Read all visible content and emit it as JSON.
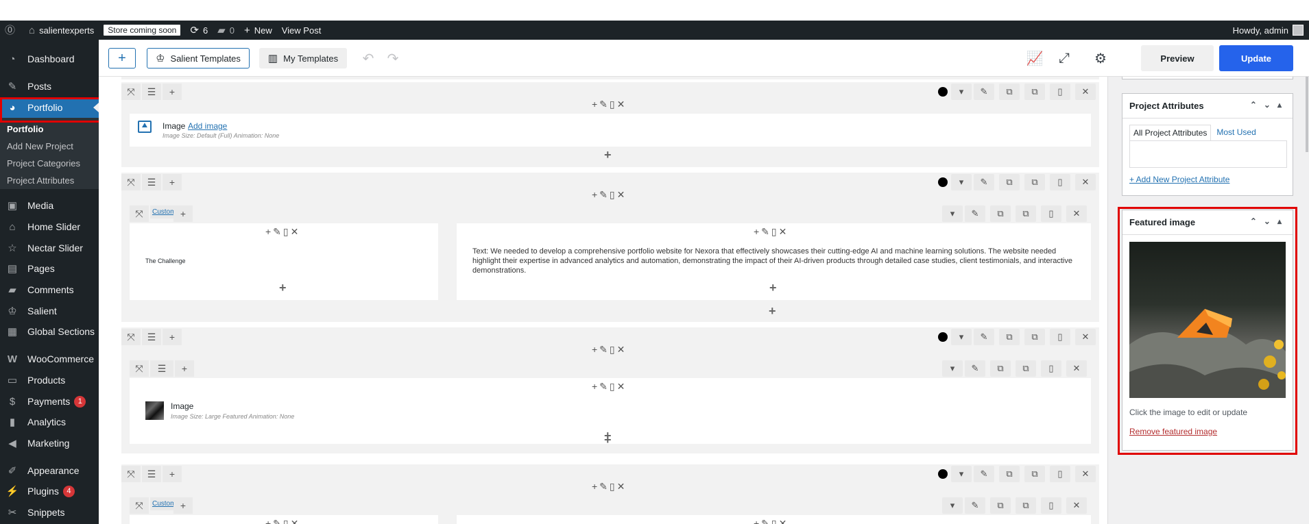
{
  "adminbar": {
    "site_name": "salientexperts",
    "store_badge": "Store coming soon",
    "updates_count": "6",
    "comments_count": "0",
    "new_label": "New",
    "view_post": "View Post",
    "howdy": "Howdy, admin"
  },
  "sidebar": {
    "dashboard": "Dashboard",
    "posts": "Posts",
    "portfolio": "Portfolio",
    "sub": {
      "portfolio": "Portfolio",
      "add_new": "Add New Project",
      "categories": "Project Categories",
      "attributes": "Project Attributes"
    },
    "media": "Media",
    "home_slider": "Home Slider",
    "nectar_slider": "Nectar Slider",
    "pages": "Pages",
    "comments": "Comments",
    "salient": "Salient",
    "global_sections": "Global Sections",
    "woocommerce": "WooCommerce",
    "products": "Products",
    "payments": "Payments",
    "payments_badge": "1",
    "analytics": "Analytics",
    "marketing": "Marketing",
    "appearance": "Appearance",
    "plugins": "Plugins",
    "plugins_badge": "4",
    "snippets": "Snippets"
  },
  "toolbar": {
    "salient_templates": "Salient Templates",
    "my_templates": "My Templates",
    "preview": "Preview",
    "update": "Update"
  },
  "canvas": {
    "row1": {
      "title": "Image",
      "link": "Add image",
      "meta": "Image Size: Default (Full)  Animation: None"
    },
    "row2": {
      "custom": "Custom",
      "left_text": "The Challenge",
      "right_text": "Text: We needed to develop a comprehensive portfolio website for Nexora that effectively showcases their cutting-edge AI and machine learning solutions. The website needed highlight their expertise in advanced analytics and automation, demonstrating the impact of their AI-driven products through detailed case studies, client testimonials, and interactive demonstrations."
    },
    "row3": {
      "title": "Image",
      "meta": "Image Size: Large Featured  Animation: None"
    },
    "row4": {
      "custom": "Custom"
    }
  },
  "rightpanel": {
    "attributes_title": "Project Attributes",
    "tab_all": "All Project Attributes",
    "tab_used": "Most Used",
    "add_attribute": "+ Add New Project Attribute",
    "featured_title": "Featured image",
    "hint": "Click the image to edit or update",
    "remove": "Remove featured image"
  },
  "colors": {
    "accent": "#2271b1",
    "admin_dark": "#1d2327",
    "highlight": "#e00000",
    "update_btn": "#2563eb"
  }
}
